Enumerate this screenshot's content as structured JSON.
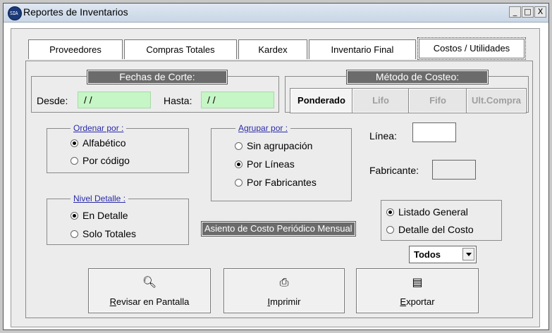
{
  "window": {
    "title": "Reportes de Inventarios",
    "icon": "app-logo-icon",
    "icon_text": "SIA",
    "controls": {
      "minimize": "_",
      "restore": "□",
      "close": "X"
    }
  },
  "tabs": [
    {
      "label": "Proveedores",
      "active": false
    },
    {
      "label": "Compras Totales",
      "active": false
    },
    {
      "label": "Kardex",
      "active": false
    },
    {
      "label": "Inventario Final",
      "active": false
    },
    {
      "label": "Costos / Utilidades",
      "active": true
    }
  ],
  "fechas": {
    "title": "Fechas de Corte:",
    "desde_label": "Desde:",
    "desde_value": " / /",
    "hasta_label": "Hasta:",
    "hasta_value": " / /"
  },
  "costeo": {
    "title": "Método de Costeo:",
    "methods": [
      {
        "label": "Ponderado",
        "selected": true
      },
      {
        "label": "Lifo",
        "selected": false
      },
      {
        "label": "Fifo",
        "selected": false
      },
      {
        "label": "Ult.Compra",
        "selected": false
      }
    ]
  },
  "ordenar": {
    "title": "Ordenar por :",
    "options": [
      {
        "label": "Alfabético",
        "selected": true
      },
      {
        "label": "Por código",
        "selected": false
      }
    ]
  },
  "agrupar": {
    "title": "Agrupar por :",
    "options": [
      {
        "label": "Sin agrupación",
        "selected": false
      },
      {
        "label": "Por Líneas",
        "selected": true
      },
      {
        "label": "Por Fabricantes",
        "selected": false
      }
    ]
  },
  "linea_label": "Línea:",
  "fabricante_label": "Fabricante:",
  "nivel": {
    "title": "Nivel Detalle :",
    "options": [
      {
        "label": "En Detalle",
        "selected": true
      },
      {
        "label": "Solo Totales",
        "selected": false
      }
    ]
  },
  "asiento_label": "Asiento de Costo Periódico Mensual",
  "listado": {
    "options": [
      {
        "label": "Listado General",
        "selected": true
      },
      {
        "label": "Detalle del Costo",
        "selected": false
      }
    ]
  },
  "todos_select": "Todos",
  "actions": [
    {
      "label_u": "R",
      "label_rest": "evisar en Pantalla",
      "icon": "preview-icon"
    },
    {
      "label_u": "I",
      "label_rest": "mprimir",
      "icon": "printer-icon"
    },
    {
      "label_u": "E",
      "label_rest": "xportar",
      "icon": "export-icon"
    }
  ]
}
